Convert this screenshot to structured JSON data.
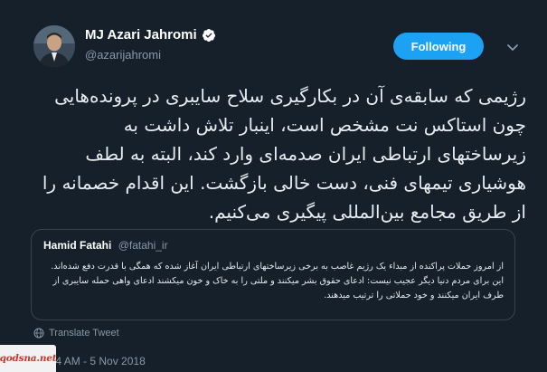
{
  "author": {
    "display_name": "MJ Azari Jahromi",
    "handle": "@azarijahromi",
    "verified_icon": "verified-badge-icon"
  },
  "follow_button": {
    "label": "Following"
  },
  "more_icon": "chevron-down-icon",
  "tweet": {
    "text": "رژیمی که سابقه‌ی آن در بکارگیری سلاح سایبری در پرونده‌هایی چون استاکس نت مشخص است، اینبار تلاش داشت به زیرساختهای ارتباطی ایران صدمه‌ای وارد کند، البته به لطف هوشیاری تیمهای فنی، دست خالی بازگشت. این اقدام خصمانه را از طریق مجامع بین‌المللی پیگیری می‌کنیم."
  },
  "quoted_tweet": {
    "name": "Hamid Fatahi",
    "handle": "@fatahi_ir",
    "text": "از امروز حملات پراکنده از مبداء یک رژیم غاصب به برخی زیرساختهای ارتباطی ایران آغاز شده که همگی با قدرت دفع شده‌اند. این برای مردم دنیا دیگر عجیب نیست: ادعای حقوق بشر میکنند و ملتی را به خاک و خون میکشند ادعای واهی حمله سایبری از طرف ایران میکنند و خود حملاتی را ترتیب میدهند."
  },
  "translate": {
    "label": "Translate Tweet",
    "icon": "globe-icon"
  },
  "timestamp": "10:24 AM - 5 Nov 2018",
  "watermark": {
    "text": "qodsna.net"
  },
  "colors": {
    "background": "#15202b",
    "accent": "#1da1f2",
    "muted": "#8899a6",
    "border": "#38444d"
  }
}
